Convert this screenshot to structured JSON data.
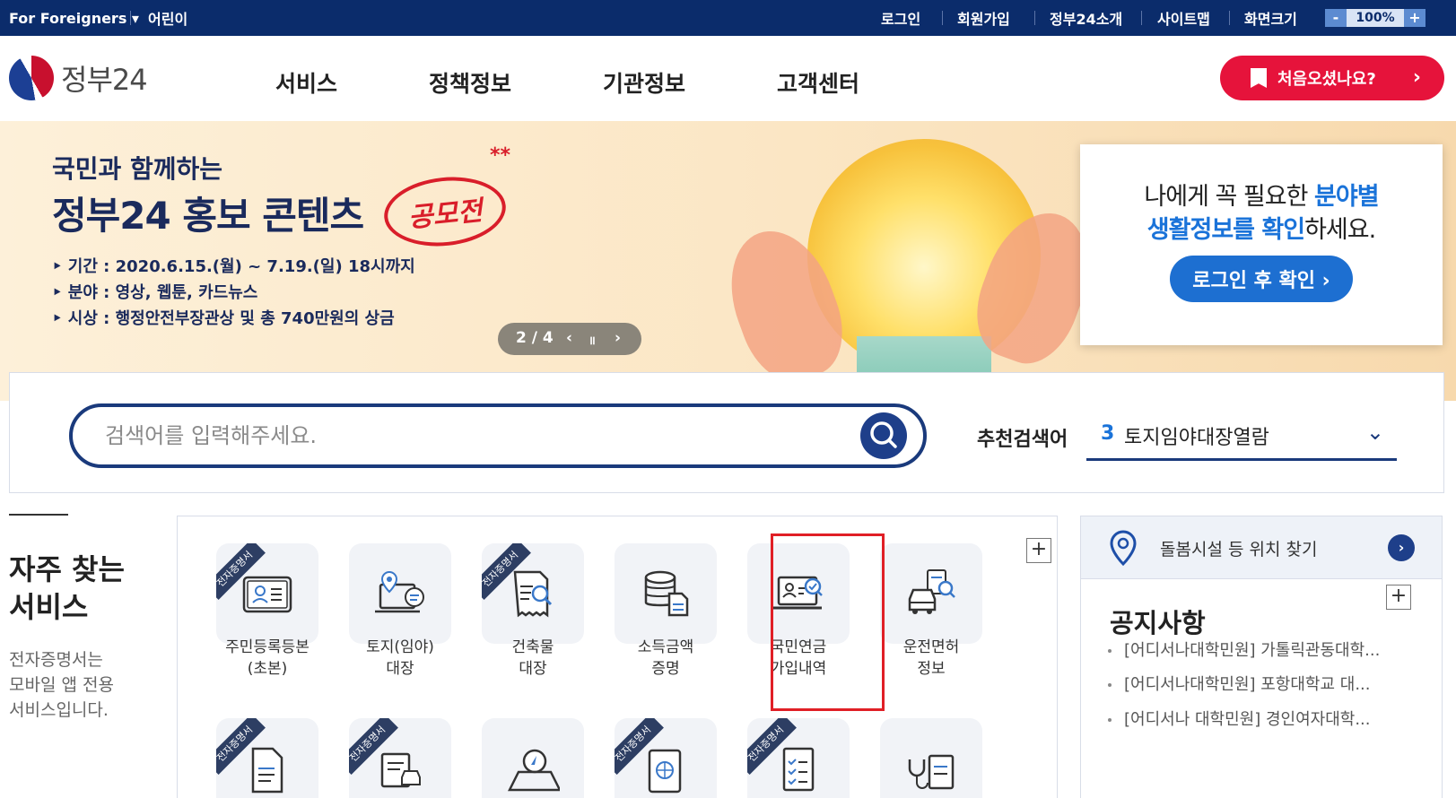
{
  "topbar": {
    "for_foreigners": "For Foreigners ▾",
    "kids": "어린이",
    "login": "로그인",
    "signup": "회원가입",
    "about": "정부24소개",
    "sitemap": "사이트맵",
    "zoom_label": "화면크기",
    "zoom_minus": "-",
    "zoom_value": "100%",
    "zoom_plus": "+"
  },
  "header": {
    "logo_text": "정부24",
    "nav": [
      "서비스",
      "정책정보",
      "기관정보",
      "고객센터"
    ],
    "first_visit_label": "처음오셨나요?",
    "first_visit_chevron": "›"
  },
  "banner": {
    "subtitle": "국민과 함께하는",
    "headline": "정부24 홍보 콘텐츠",
    "stamp_text": "공모전",
    "stars": "**",
    "info": [
      "‣ 기간 : 2020.6.15.(월) ~ 7.19.(일) 18시까지",
      "‣ 분야 : 영상, 웹툰, 카드뉴스",
      "‣ 시상 : 행정안전부장관상 및 총 740만원의 상금"
    ],
    "pager": {
      "current": "2 / 4",
      "prev": "‹",
      "pause": "॥",
      "next": "›"
    }
  },
  "side_card": {
    "line1_a": "나에게 꼭 필요한 ",
    "line1_b": "분야별",
    "line2_a": "생활정보를 확인",
    "line2_b": "하세요.",
    "login_button": "로그인 후 확인 ›"
  },
  "search": {
    "placeholder": "검색어를 입력해주세요.",
    "recommend_label": "추천검색어",
    "recommend_num": "3",
    "recommend_text": "토지임야대장열람",
    "recommend_chevron": "⌄"
  },
  "freq": {
    "title_line1": "자주 찾는",
    "title_line2": "서비스",
    "desc_line1": "전자증명서는",
    "desc_line2": "모바일 앱 전용",
    "desc_line3": "서비스입니다."
  },
  "services": {
    "ribbon": "전자증명서",
    "row1": [
      {
        "l1": "주민등록등본",
        "l2": "(초본)",
        "icon": "id-card-icon"
      },
      {
        "l1": "토지(임야)",
        "l2": "대장",
        "icon": "land-map-icon"
      },
      {
        "l1": "건축물",
        "l2": "대장",
        "icon": "document-search-icon"
      },
      {
        "l1": "소득금액",
        "l2": "증명",
        "icon": "database-icon"
      },
      {
        "l1": "국민연금",
        "l2": "가입내역",
        "icon": "laptop-profile-icon"
      },
      {
        "l1": "운전면허",
        "l2": "정보",
        "icon": "car-license-icon"
      }
    ],
    "plus": "+"
  },
  "right_panel": {
    "location_text": "돌봄시설 등 위치 찾기",
    "location_go": "›",
    "notice_title": "공지사항",
    "notice_plus": "+",
    "notices": [
      "[어디서나대학민원] 가톨릭관동대학...",
      "[어디서나대학민원] 포항대학교 대...",
      "[어디서나 대학민원] 경인여자대학..."
    ]
  },
  "colors": {
    "topbar_bg": "#0b2c6b",
    "accent_red": "#e6133b",
    "accent_blue": "#1d6fd1",
    "search_border": "#1a3a7c",
    "highlight_red": "#e01f26"
  }
}
